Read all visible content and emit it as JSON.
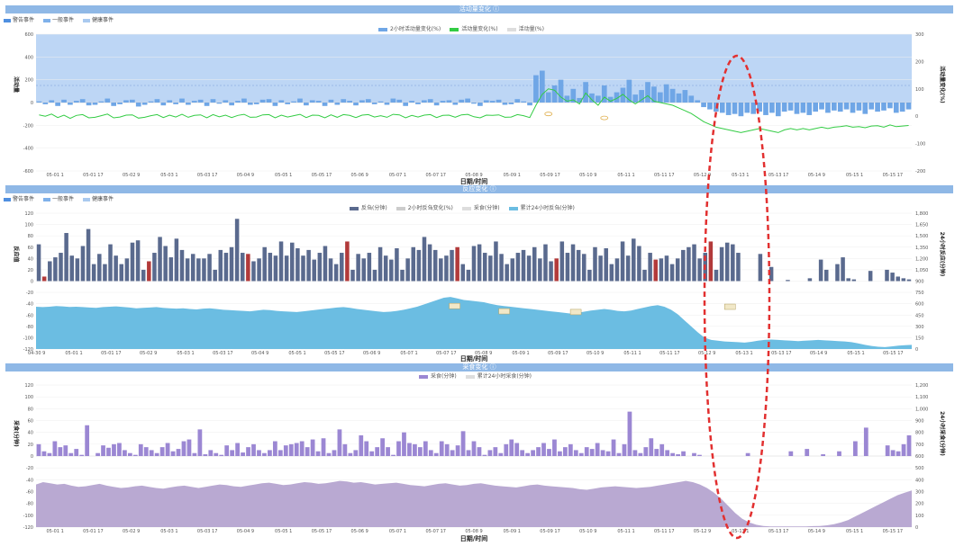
{
  "panels": {
    "p1": {
      "title": "活动量变化 ⓘ"
    },
    "p2": {
      "title": "反应变化 ⓘ"
    },
    "p3": {
      "title": "采食变化 ⓘ"
    }
  },
  "event_legend": [
    {
      "label": "警告事件",
      "color": "#4f8fe0"
    },
    {
      "label": "一般事件",
      "color": "#7fb1ea"
    },
    {
      "label": "健康事件",
      "color": "#a9c9ef"
    }
  ],
  "colors": {
    "accent_bar": "#8fb8e6",
    "bar_blue": "#6fa6e6",
    "band_blue": "#bdd6f5",
    "bar_navy": "#5a6a8e",
    "bar_red": "#b23a3a",
    "area_teal": "#6bbde2",
    "bar_purple": "#9b87d3",
    "area_purple": "#b9a9d2",
    "line_green": "#33cc44",
    "highlight_red": "#e23030"
  },
  "chart_data": [
    {
      "type": "bar",
      "title": "活动量变化",
      "xlabel": "日期/时间",
      "ylabel": "活动量",
      "ylabel_right": "活动量变化(%)",
      "series_legend": [
        "2小时活动量变化(%)",
        "活动量变化(%)",
        "活动量(%)"
      ],
      "ylim": [
        -600,
        600
      ],
      "y2lim": [
        -200,
        300
      ],
      "yticks": [
        600,
        400,
        200,
        0,
        -200,
        -400,
        -600
      ],
      "y2ticks": [
        300,
        200,
        100,
        0,
        -100,
        -200
      ],
      "band": [
        0,
        600
      ],
      "xticks": [
        "05-01 1",
        "05-01 17",
        "05-02 9",
        "05-03 1",
        "05-03 17",
        "05-04 9",
        "05-05 1",
        "05-05 17",
        "05-06 9",
        "05-07 1",
        "05-07 17",
        "05-08 9",
        "05-09 1",
        "05-09 17",
        "05-10 9",
        "05-11 1",
        "05-11 17",
        "05-12 9",
        "05-13 1",
        "05-13 17",
        "05-14 9",
        "05-15 1",
        "05-15 17"
      ],
      "bars": [
        10,
        -15,
        20,
        -30,
        25,
        -20,
        15,
        30,
        -25,
        -20,
        10,
        35,
        -30,
        -15,
        20,
        25,
        -35,
        -20,
        10,
        30,
        -25,
        20,
        -15,
        35,
        -20,
        15,
        25,
        -30,
        30,
        -10,
        20,
        -25,
        15,
        35,
        -20,
        -15,
        25,
        30,
        -30,
        20,
        -15,
        10,
        35,
        -25,
        20,
        15,
        -30,
        25,
        -20,
        30,
        15,
        -25,
        20,
        30,
        -15,
        10,
        -20,
        35,
        25,
        -30,
        15,
        -15,
        20,
        30,
        -25,
        15,
        20,
        -20,
        25,
        35,
        -10,
        -30,
        20,
        15,
        25,
        -20,
        -15,
        30,
        10,
        -25,
        240,
        280,
        90,
        150,
        200,
        60,
        120,
        40,
        180,
        80,
        60,
        150,
        50,
        90,
        130,
        200,
        70,
        110,
        180,
        140,
        90,
        160,
        120,
        80,
        110,
        60,
        20,
        -40,
        -60,
        -80,
        -90,
        -110,
        -100,
        -120,
        -90,
        -100,
        -80,
        -110,
        -90,
        -120,
        -80,
        -70,
        -100,
        -90,
        -110,
        -80,
        -60,
        -90,
        -70,
        -80,
        -60,
        -90,
        -70,
        -100,
        -60,
        -80,
        -70,
        -50,
        -90,
        -80,
        -60
      ],
      "line": [
        5,
        0,
        8,
        -5,
        4,
        -8,
        3,
        6,
        -6,
        -4,
        2,
        8,
        -6,
        -3,
        4,
        5,
        -7,
        -4,
        2,
        6,
        -5,
        4,
        -3,
        7,
        -4,
        3,
        5,
        -6,
        6,
        -2,
        4,
        -5,
        3,
        7,
        -4,
        -3,
        5,
        6,
        -6,
        4,
        -3,
        2,
        7,
        -5,
        4,
        3,
        -6,
        5,
        -4,
        6,
        3,
        -5,
        4,
        6,
        -3,
        2,
        -4,
        7,
        5,
        -6,
        3,
        -3,
        4,
        6,
        -5,
        3,
        4,
        -4,
        5,
        7,
        -2,
        -6,
        4,
        3,
        5,
        -4,
        -3,
        6,
        2,
        -5,
        40,
        80,
        100,
        95,
        70,
        55,
        60,
        45,
        85,
        60,
        40,
        70,
        55,
        65,
        80,
        60,
        45,
        60,
        75,
        55,
        50,
        45,
        40,
        30,
        20,
        10,
        -5,
        -20,
        -30,
        -40,
        -45,
        -50,
        -55,
        -60,
        -55,
        -50,
        -45,
        -50,
        -55,
        -60,
        -50,
        -45,
        -50,
        -45,
        -50,
        -45,
        -40,
        -45,
        -40,
        -38,
        -35,
        -40,
        -38,
        -42,
        -36,
        -35,
        -40,
        -32,
        -38,
        -36,
        -34
      ],
      "markers": [
        {
          "x": 82,
          "y": -100
        },
        {
          "x": 91,
          "y": -135
        }
      ]
    },
    {
      "type": "bar",
      "title": "反应变化",
      "xlabel": "日期/时间",
      "ylabel": "反应值",
      "ylabel_right": "24小时反应(分钟)",
      "series_legend": [
        "反刍(分钟)",
        "2小时反刍变化(%)",
        "采食(分钟)",
        "累计24小时反刍(分钟)"
      ],
      "ylim": [
        -120,
        120
      ],
      "y2lim": [
        0,
        1800
      ],
      "yticks": [
        120,
        100,
        80,
        60,
        40,
        20,
        0,
        -20,
        -40,
        -60,
        -80,
        -100,
        -120
      ],
      "y2ticks": [
        1800,
        1650,
        1500,
        1350,
        1200,
        1050,
        900,
        750,
        600,
        450,
        300,
        150,
        0
      ],
      "xticks": [
        "04-30 9",
        "05-01 1",
        "05-01 17",
        "05-02 9",
        "05-03 1",
        "05-03 17",
        "05-04 9",
        "05-05 1",
        "05-05 17",
        "05-06 9",
        "05-07 1",
        "05-07 17",
        "05-08 9",
        "05-09 1",
        "05-09 17",
        "05-10 9",
        "05-11 1",
        "05-11 17",
        "05-12 9",
        "05-13 1",
        "05-13 17",
        "05-14 9",
        "05-15 1",
        "05-15 17"
      ],
      "bars": [
        65,
        8,
        35,
        42,
        50,
        85,
        45,
        40,
        62,
        92,
        30,
        48,
        30,
        65,
        45,
        30,
        40,
        68,
        72,
        20,
        35,
        50,
        78,
        62,
        42,
        75,
        55,
        40,
        48,
        40,
        40,
        48,
        20,
        55,
        50,
        60,
        110,
        50,
        48,
        35,
        40,
        60,
        50,
        45,
        70,
        45,
        68,
        58,
        45,
        55,
        38,
        50,
        62,
        40,
        30,
        50,
        70,
        20,
        48,
        40,
        50,
        20,
        60,
        45,
        38,
        58,
        20,
        40,
        60,
        55,
        78,
        65,
        55,
        40,
        45,
        55,
        60,
        30,
        20,
        62,
        65,
        50,
        45,
        70,
        48,
        30,
        40,
        50,
        55,
        45,
        60,
        40,
        65,
        35,
        40,
        70,
        50,
        65,
        55,
        48,
        20,
        60,
        45,
        58,
        30,
        40,
        70,
        45,
        75,
        62,
        20,
        50,
        38,
        40,
        45,
        30,
        40,
        55,
        60,
        65,
        40,
        50,
        70,
        20,
        60,
        68,
        65,
        50
      ],
      "bars_tail": [
        0,
        0,
        0,
        48,
        0,
        25,
        0,
        0,
        2,
        0,
        0,
        0,
        5,
        0,
        38,
        20,
        0,
        30,
        42,
        5,
        3,
        0,
        0,
        18,
        0,
        0,
        20,
        15,
        8,
        5,
        3
      ],
      "red_bars": [
        1,
        20,
        38,
        56,
        76,
        94,
        112,
        122
      ],
      "area": [
        560,
        555,
        560,
        570,
        565,
        558,
        560,
        555,
        550,
        545,
        555,
        560,
        565,
        558,
        550,
        540,
        545,
        550,
        555,
        545,
        540,
        535,
        540,
        530,
        525,
        535,
        540,
        530,
        520,
        515,
        510,
        505,
        500,
        510,
        520,
        515,
        505,
        500,
        495,
        490,
        500,
        510,
        520,
        530,
        540,
        550,
        555,
        545,
        530,
        520,
        510,
        500,
        490,
        495,
        505,
        520,
        540,
        560,
        590,
        620,
        650,
        680,
        690,
        670,
        650,
        640,
        630,
        620,
        600,
        580,
        570,
        560,
        550,
        540,
        530,
        520,
        510,
        500,
        490,
        480,
        470,
        480,
        495,
        510,
        520,
        530,
        520,
        505,
        500,
        510,
        530,
        550,
        570,
        580,
        560,
        520,
        460,
        380,
        300,
        220,
        150,
        120,
        110,
        100,
        95,
        90,
        85,
        95,
        110,
        120,
        125,
        120,
        115,
        110,
        105,
        110,
        115,
        120,
        115,
        110,
        105,
        100,
        90,
        75,
        55,
        40,
        30,
        25,
        35,
        45,
        50,
        55
      ],
      "markers": [
        {
          "x": 76,
          "y": 570
        },
        {
          "x": 85,
          "y": 500
        },
        {
          "x": 98,
          "y": 490
        },
        {
          "x": 126,
          "y": 560
        }
      ]
    },
    {
      "type": "bar",
      "title": "采食变化",
      "xlabel": "日期/时间",
      "ylabel": "采食(分钟)",
      "ylabel_right": "24小时采食(分钟)",
      "series_legend": [
        "采食(分钟)",
        "累计24小时采食(分钟)"
      ],
      "ylim": [
        -120,
        120
      ],
      "y2lim": [
        0,
        1200
      ],
      "yticks": [
        120,
        100,
        80,
        60,
        40,
        20,
        0,
        -20,
        -40,
        -60,
        -80,
        -100,
        -120
      ],
      "y2ticks": [
        1200,
        1100,
        1000,
        900,
        800,
        700,
        600,
        500,
        400,
        300,
        200,
        100,
        0
      ],
      "xticks": [
        "05-01 1",
        "05-01 17",
        "05-02 9",
        "05-03 1",
        "05-03 17",
        "05-04 9",
        "05-05 1",
        "05-05 17",
        "05-06 9",
        "05-07 1",
        "05-07 17",
        "05-08 9",
        "05-09 1",
        "05-09 17",
        "05-10 9",
        "05-11 1",
        "05-11 17",
        "05-12 9",
        "05-13 1",
        "05-13 17",
        "05-14 9",
        "05-15 1",
        "05-15 17"
      ],
      "bars": [
        20,
        8,
        5,
        25,
        15,
        18,
        5,
        12,
        2,
        52,
        0,
        5,
        18,
        14,
        20,
        22,
        10,
        5,
        2,
        20,
        15,
        10,
        5,
        15,
        22,
        8,
        12,
        25,
        28,
        5,
        45,
        3,
        10,
        5,
        2,
        18,
        10,
        22,
        6,
        15,
        20,
        10,
        5,
        10,
        25,
        10,
        18,
        20,
        22,
        25,
        15,
        28,
        8,
        30,
        5,
        10,
        45,
        20,
        5,
        10,
        35,
        25,
        8,
        15,
        30,
        15,
        2,
        25,
        40,
        22,
        20,
        15,
        25,
        10,
        5,
        25,
        20,
        10,
        18,
        42,
        10,
        25,
        15,
        2,
        10,
        15,
        5,
        20,
        28,
        22,
        10,
        5,
        10,
        15,
        22,
        12,
        28,
        8,
        15,
        20,
        10,
        5,
        15,
        12,
        22,
        10,
        8,
        28,
        5,
        20,
        75,
        10,
        5,
        15,
        30,
        12,
        20,
        10,
        5,
        3,
        8,
        0,
        5,
        2,
        0,
        0,
        0,
        0,
        0,
        0,
        0,
        0,
        5,
        0,
        0,
        0,
        0,
        0,
        0,
        0,
        8,
        0,
        0,
        12,
        0,
        0,
        3,
        0,
        0,
        8,
        0,
        0,
        25,
        0,
        48,
        0,
        0,
        0,
        18,
        10,
        8,
        20,
        35
      ],
      "area": [
        360,
        380,
        370,
        360,
        365,
        350,
        340,
        345,
        355,
        365,
        350,
        340,
        330,
        335,
        345,
        350,
        340,
        330,
        325,
        335,
        345,
        350,
        340,
        330,
        340,
        350,
        360,
        355,
        345,
        340,
        350,
        360,
        370,
        375,
        365,
        355,
        360,
        370,
        380,
        375,
        365,
        370,
        380,
        390,
        385,
        375,
        380,
        370,
        360,
        365,
        370,
        375,
        365,
        355,
        350,
        345,
        355,
        365,
        370,
        360,
        350,
        355,
        365,
        370,
        360,
        350,
        345,
        340,
        335,
        345,
        355,
        360,
        350,
        345,
        340,
        335,
        330,
        320,
        315,
        325,
        335,
        340,
        345,
        340,
        335,
        330,
        335,
        340,
        350,
        360,
        370,
        380,
        390,
        380,
        360,
        330,
        290,
        240,
        180,
        120,
        70,
        40,
        20,
        10,
        5,
        5,
        5,
        5,
        5,
        5,
        8,
        10,
        15,
        25,
        40,
        60,
        90,
        120,
        150,
        180,
        210,
        240,
        270,
        290,
        310
      ]
    }
  ]
}
